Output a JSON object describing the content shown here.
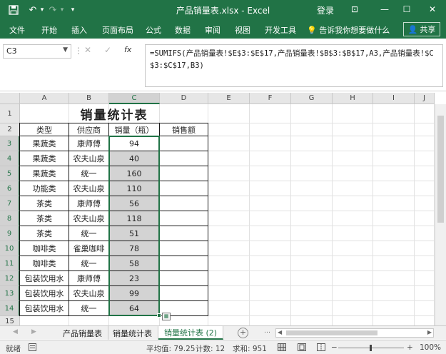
{
  "window": {
    "title": "产品销量表.xlsx - Excel",
    "login": "登录",
    "minimize": "—",
    "maximize": "☐",
    "close": "✕",
    "restore": "⊡"
  },
  "quick_access": {
    "save_icon": "save-icon",
    "undo": "↶",
    "redo": "↷",
    "more": "▾"
  },
  "ribbon": {
    "tabs": [
      "文件",
      "开始",
      "插入",
      "页面布局",
      "公式",
      "数据",
      "审阅",
      "视图",
      "开发工具"
    ],
    "tell_me": "告诉我你想要做什么",
    "share": "共享"
  },
  "formula_bar": {
    "name_box": "C3",
    "cancel": "✕",
    "enter": "✓",
    "fx": "fx",
    "formula": "=SUMIFS(产品销量表!$E$3:$E$17,产品销量表!$B$3:$B$17,A3,产品销量表!$C$3:$C$17,B3)"
  },
  "grid": {
    "columns": [
      "A",
      "B",
      "C",
      "D",
      "E",
      "F",
      "G",
      "H",
      "I",
      "J"
    ],
    "rows": [
      "1",
      "2",
      "3",
      "4",
      "5",
      "6",
      "7",
      "8",
      "9",
      "10",
      "11",
      "12",
      "13",
      "14",
      "15"
    ],
    "title": "销量统计表",
    "headers": [
      "类型",
      "供应商",
      "销量（瓶）",
      "销售额"
    ],
    "data": [
      [
        "果蔬类",
        "康师傅",
        "94",
        ""
      ],
      [
        "果蔬类",
        "农夫山泉",
        "40",
        ""
      ],
      [
        "果蔬类",
        "统一",
        "160",
        ""
      ],
      [
        "功能类",
        "农夫山泉",
        "110",
        ""
      ],
      [
        "茶类",
        "康师傅",
        "56",
        ""
      ],
      [
        "茶类",
        "农夫山泉",
        "118",
        ""
      ],
      [
        "茶类",
        "统一",
        "51",
        ""
      ],
      [
        "咖啡类",
        "雀巢咖啡",
        "78",
        ""
      ],
      [
        "咖啡类",
        "统一",
        "58",
        ""
      ],
      [
        "包装饮用水",
        "康师傅",
        "23",
        ""
      ],
      [
        "包装饮用水",
        "农夫山泉",
        "99",
        ""
      ],
      [
        "包装饮用水",
        "统一",
        "64",
        ""
      ]
    ]
  },
  "sheets": {
    "tabs": [
      "产品销量表",
      "销量统计表",
      "销量统计表 (2)"
    ],
    "active": "销量统计表 (2)",
    "nav_prev": "◀",
    "nav_next": "▶",
    "add": "+",
    "more": "…"
  },
  "status": {
    "ready": "就绪",
    "average": "平均值: 79.25",
    "count": "计数: 12",
    "sum": "求和: 951",
    "zoom_minus": "−",
    "zoom_plus": "+",
    "zoom": "100%"
  },
  "colors": {
    "accent": "#217346",
    "selection_fill": "#d3d3d3"
  }
}
